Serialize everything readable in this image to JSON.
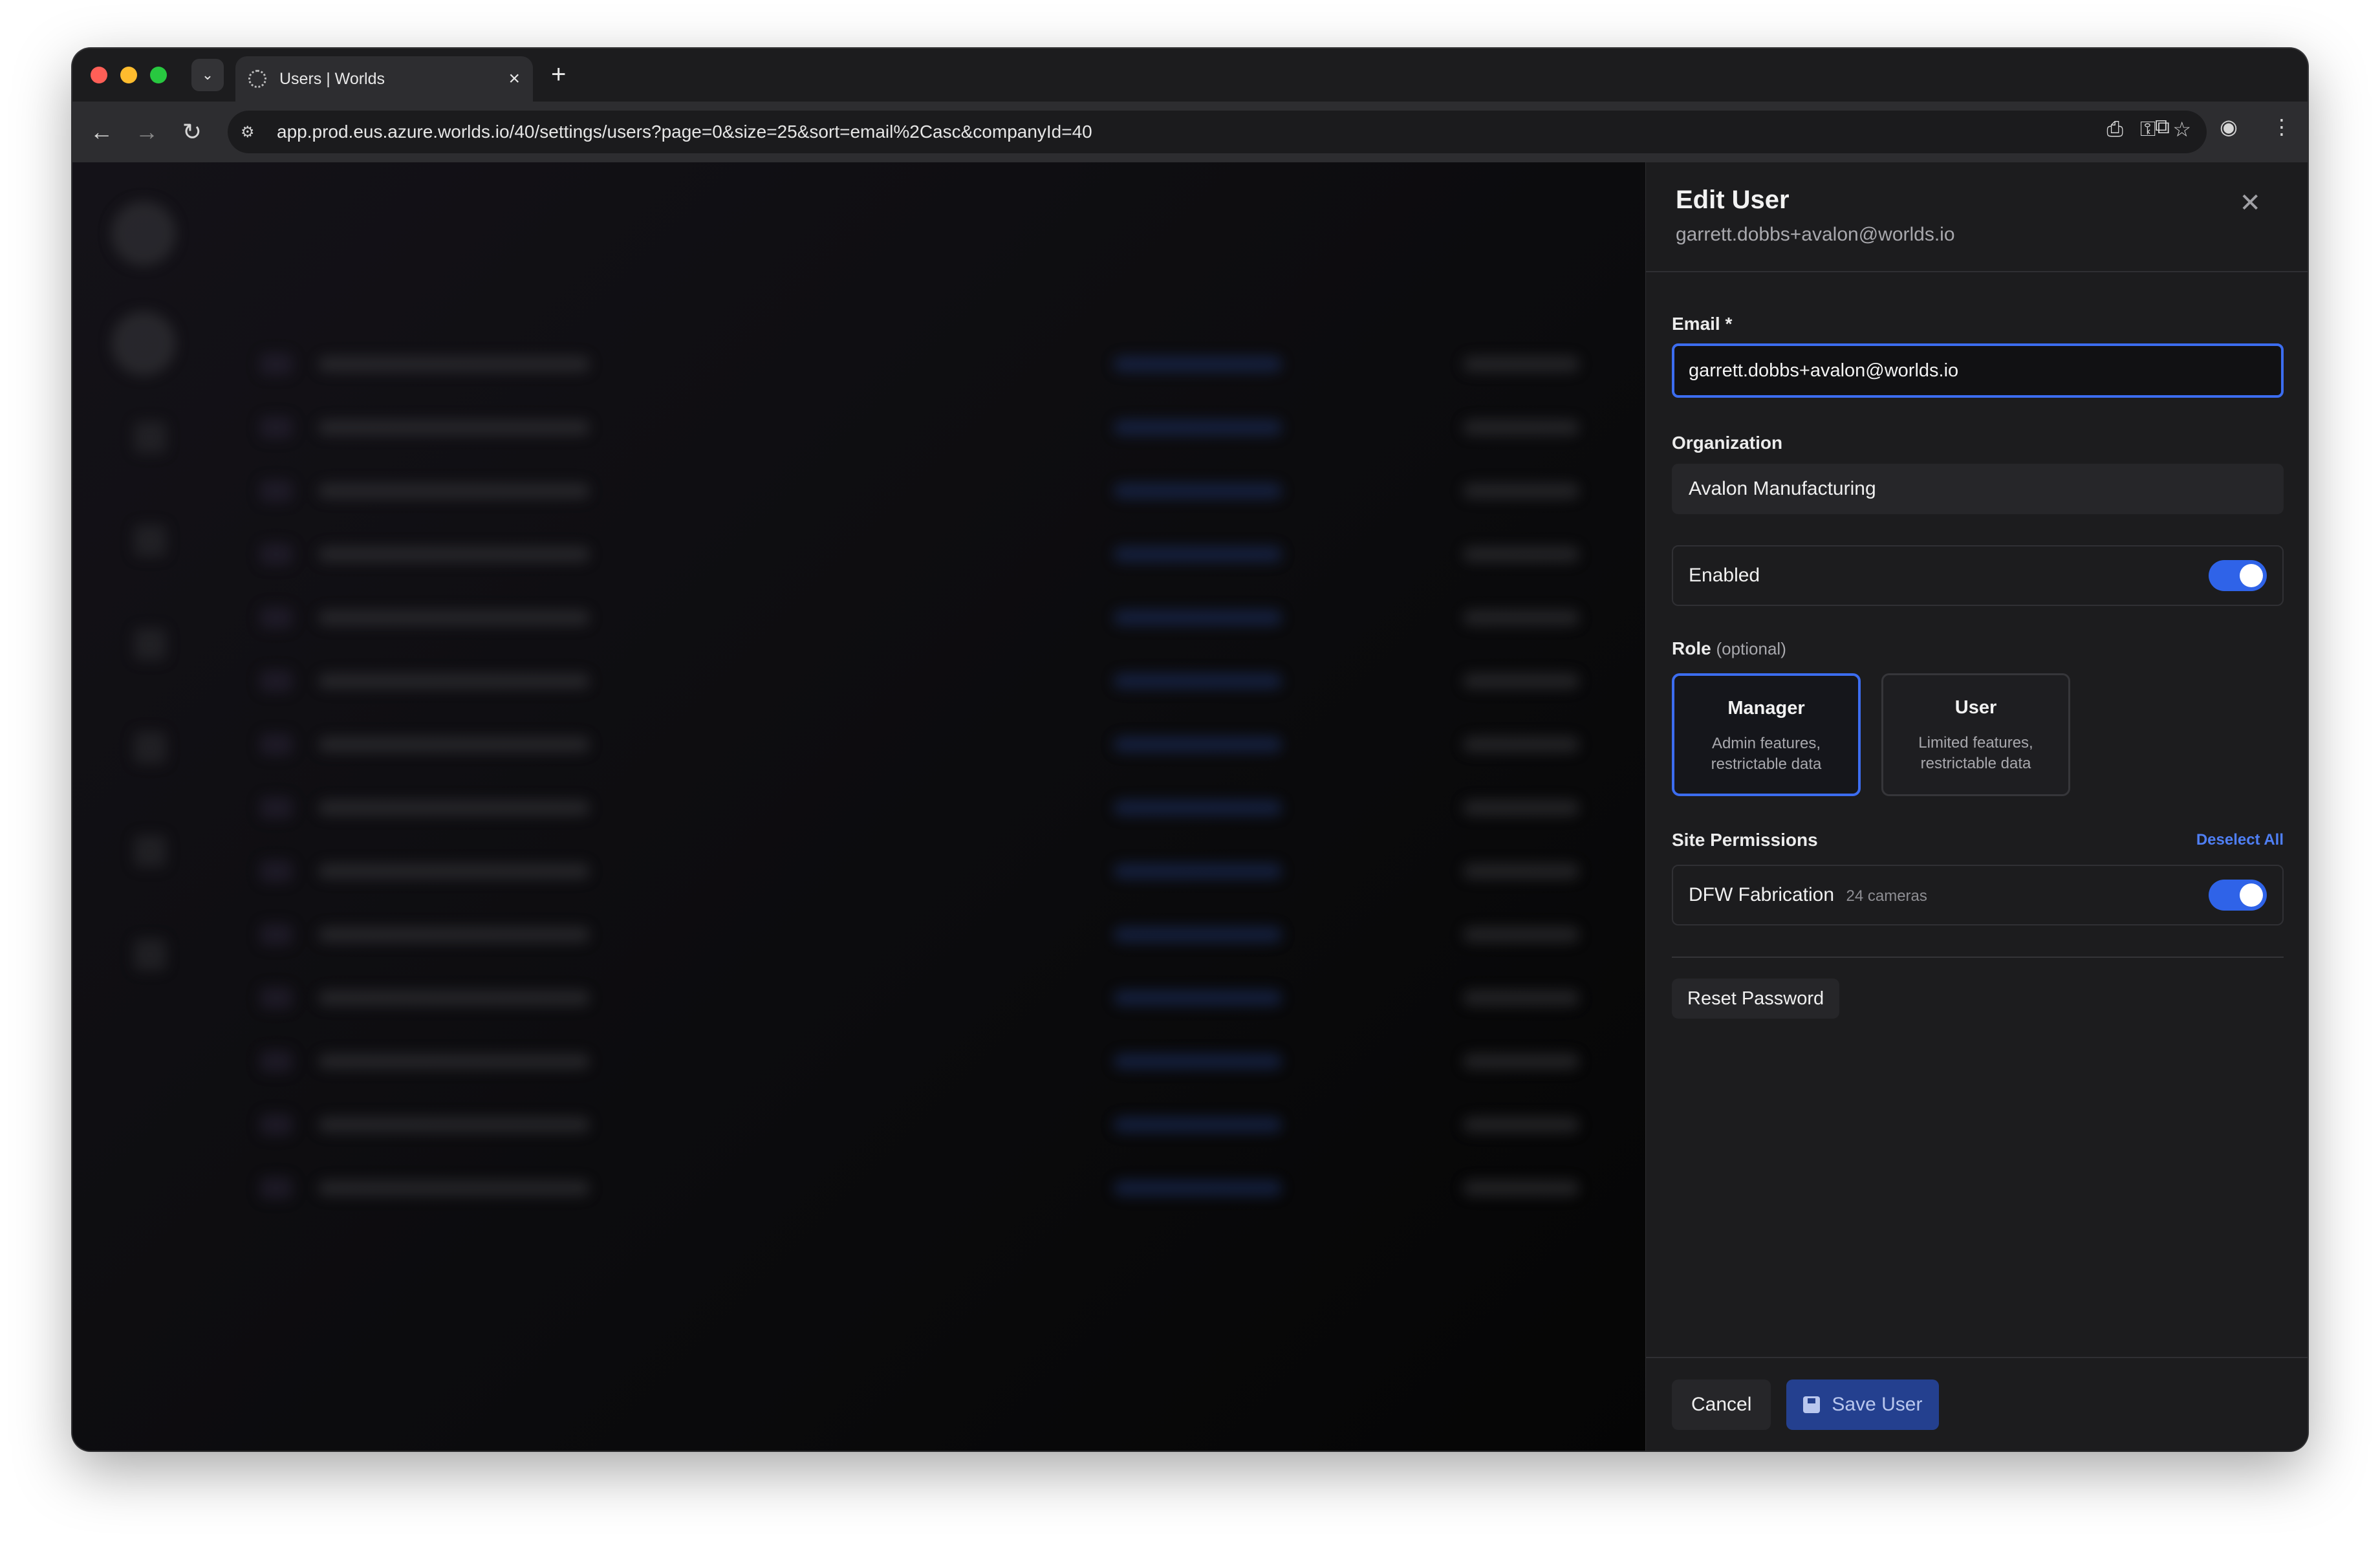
{
  "browser": {
    "tab_title": "Users | Worlds",
    "url": "app.prod.eus.azure.worlds.io/40/settings/users?page=0&size=25&sort=email%2Casc&companyId=40"
  },
  "panel": {
    "title": "Edit User",
    "subtitle": "garrett.dobbs+avalon@worlds.io",
    "email_label": "Email",
    "email_required_mark": "*",
    "email_value": "garrett.dobbs+avalon@worlds.io",
    "organization_label": "Organization",
    "organization_value": "Avalon Manufacturing",
    "enabled_label": "Enabled",
    "enabled": true,
    "role_label": "Role",
    "role_optional": "(optional)",
    "roles": [
      {
        "name": "Manager",
        "desc_line1": "Admin features,",
        "desc_line2": "restrictable data",
        "selected": true
      },
      {
        "name": "User",
        "desc_line1": "Limited features,",
        "desc_line2": "restrictable data",
        "selected": false
      }
    ],
    "site_permissions_label": "Site Permissions",
    "deselect_all": "Deselect All",
    "sites": [
      {
        "name": "DFW Fabrication",
        "count": "24 cameras",
        "enabled": true
      }
    ],
    "reset_password": "Reset Password",
    "cancel": "Cancel",
    "save": "Save User"
  },
  "colors": {
    "accent": "#3c6df0",
    "toggle_on": "#2f63e8",
    "save_button": "#24408f"
  }
}
